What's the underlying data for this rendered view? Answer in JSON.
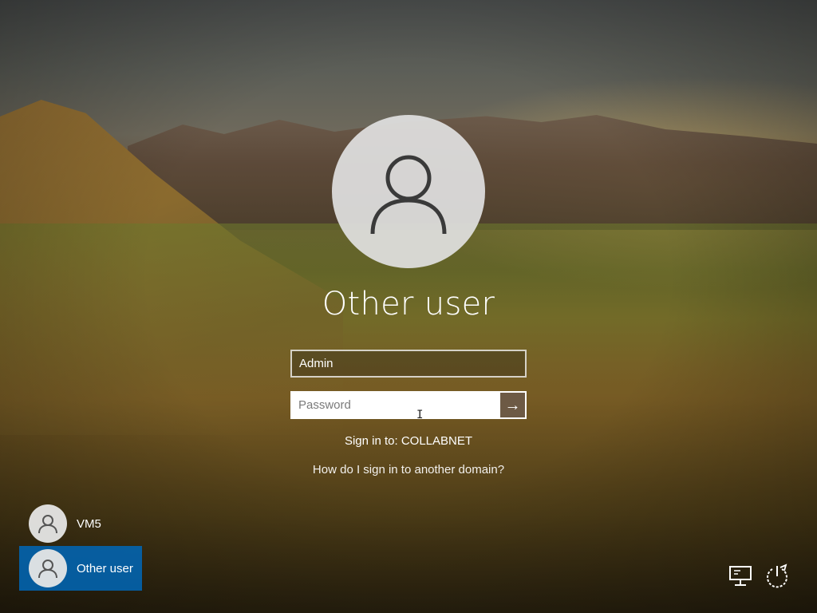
{
  "login": {
    "display_name": "Other user",
    "username_value": "Admin",
    "password_placeholder": "Password",
    "signin_target": "Sign in to: COLLABNET",
    "other_domain_link": "How do I sign in to another domain?"
  },
  "user_list": [
    {
      "name": "VM5",
      "selected": false
    },
    {
      "name": "Other user",
      "selected": true
    }
  ],
  "icons": {
    "avatar": "person-icon",
    "submit": "arrow-right-icon",
    "network": "network-icon",
    "power": "power-icon"
  },
  "colors": {
    "selected_tile": "#0067b8",
    "submit_button": "#6d5a45"
  }
}
